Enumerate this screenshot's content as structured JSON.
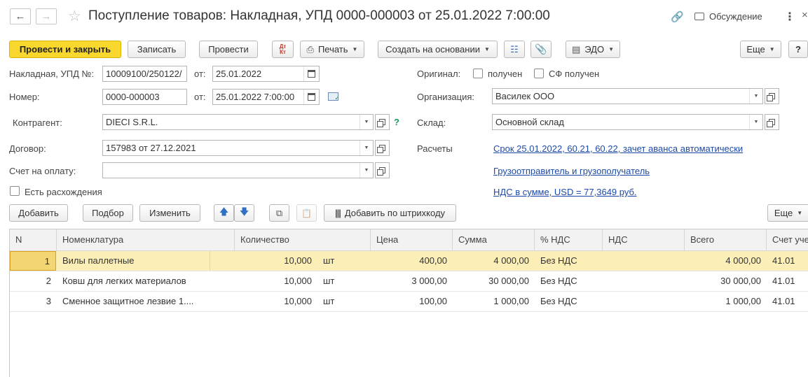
{
  "title": "Поступление товаров: Накладная, УПД 0000-000003 от 25.01.2022 7:00:00",
  "header_right": {
    "discussion": "Обсуждение"
  },
  "toolbar": {
    "post_close": "Провести и закрыть",
    "save": "Записать",
    "post": "Провести",
    "dt_kt": "Дт Кт",
    "print": "Печать",
    "create_based": "Создать на основании",
    "edo": "ЭДО",
    "more": "Еще",
    "help": "?"
  },
  "form": {
    "invoice_label": "Накладная, УПД №:",
    "invoice_value": "10009100/250122/",
    "from_label": "от:",
    "invoice_date": "25.01.2022",
    "number_label": "Номер:",
    "number_value": "0000-000003",
    "number_date": "25.01.2022  7:00:00",
    "contractor_label": "Контрагент:",
    "contractor_value": "DIECI S.R.L.",
    "help_mark": "?",
    "contract_label": "Договор:",
    "contract_value": "157983 от 27.12.2021",
    "payment_label": "Счет на оплату:",
    "payment_value": "",
    "discrepancy_label": "Есть расхождения",
    "original_label": "Оригинал:",
    "received_label": "получен",
    "sf_received_label": "СФ получен",
    "org_label": "Организация:",
    "org_value": "Василек ООО",
    "warehouse_label": "Склад:",
    "warehouse_value": "Основной склад",
    "settlements_label": "Расчеты",
    "settlements_link": "Срок 25.01.2022, 60.21, 60.22, зачет аванса автоматически",
    "shipper_link": "Грузоотправитель и грузополучатель",
    "vat_link": "НДС в сумме, USD = 77,3649 руб."
  },
  "table_toolbar": {
    "add": "Добавить",
    "pick": "Подбор",
    "change": "Изменить",
    "barcode": "Добавить по штрихкоду",
    "more": "Еще"
  },
  "table": {
    "columns": [
      "N",
      "Номенклатура",
      "Количество",
      "Цена",
      "Сумма",
      "% НДС",
      "НДС",
      "Всего",
      "Счет уче"
    ],
    "rows": [
      {
        "n": "1",
        "name": "Вилы паллетные",
        "qty": "10,000",
        "unit": "шт",
        "price": "400,00",
        "sum": "4 000,00",
        "vat_rate": "Без НДС",
        "vat": "",
        "total": "4 000,00",
        "account": "41.01"
      },
      {
        "n": "2",
        "name": "Ковш для легких материалов",
        "qty": "10,000",
        "unit": "шт",
        "price": "3 000,00",
        "sum": "30 000,00",
        "vat_rate": "Без НДС",
        "vat": "",
        "total": "30 000,00",
        "account": "41.01"
      },
      {
        "n": "3",
        "name": "Сменное защитное лезвие 1....",
        "qty": "10,000",
        "unit": "шт",
        "price": "100,00",
        "sum": "1 000,00",
        "vat_rate": "Без НДС",
        "vat": "",
        "total": "1 000,00",
        "account": "41.01"
      }
    ]
  },
  "colors": {
    "accent_yellow": "#f9d72d",
    "selected_row": "#fbeeb7",
    "link": "#1d4aa8"
  }
}
